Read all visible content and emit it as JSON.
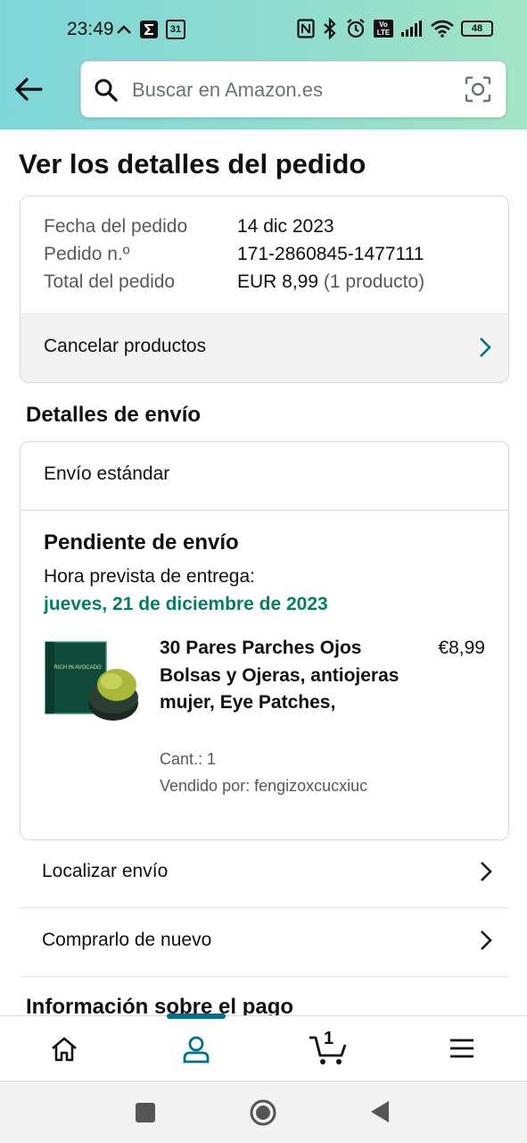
{
  "status_bar": {
    "time": "23:49",
    "date_icon_text": "31",
    "volte_text": "Vo LTE",
    "battery": "48",
    "icons": [
      "nfc-icon",
      "bluetooth-icon",
      "alarm-icon",
      "volte-icon",
      "signal-icon",
      "wifi-icon",
      "battery-icon"
    ]
  },
  "header": {
    "search_placeholder": "Buscar en Amazon.es",
    "icons": [
      "back-arrow-icon",
      "search-icon",
      "camera-icon"
    ]
  },
  "page_title": "Ver los detalles del pedido",
  "order_summary": {
    "rows": [
      {
        "label": "Fecha del pedido",
        "value": "14 dic 2023",
        "extra": ""
      },
      {
        "label": "Pedido n.º",
        "value": "171-2860845-1477111",
        "extra": ""
      },
      {
        "label": "Total del pedido",
        "value": "EUR 8,99",
        "extra": "(1 producto)"
      }
    ],
    "cancel_label": "Cancelar productos"
  },
  "shipping": {
    "section_title": "Detalles de envío",
    "method": "Envío estándar",
    "status_heading": "Pendiente de envío",
    "eta_label": "Hora prevista de entrega:",
    "eta_date": "jueves, 21 de diciembre de 2023",
    "item": {
      "name": "30 Pares Parches Ojos Bolsas y Ojeras, antiojeras mujer, Eye Patches,",
      "price": "€8,99",
      "quantity": "Cant.: 1",
      "seller": "Vendido por: fengizoxcucxiuc",
      "thumb_text": "RICH IN AVOCADO"
    }
  },
  "actions": [
    {
      "label": "Localizar envío"
    },
    {
      "label": "Comprarlo de nuevo"
    }
  ],
  "payment_title": "Información sobre el pago",
  "bottom_nav": {
    "tabs": [
      "home-icon",
      "account-icon",
      "cart-icon",
      "menu-icon"
    ],
    "active": "account-icon",
    "cart_count": "1"
  },
  "colors": {
    "accent": "#007185",
    "delivery_green": "#067d62",
    "header_gradient_start": "#7fd6d9",
    "header_gradient_end": "#a3e4c5"
  }
}
